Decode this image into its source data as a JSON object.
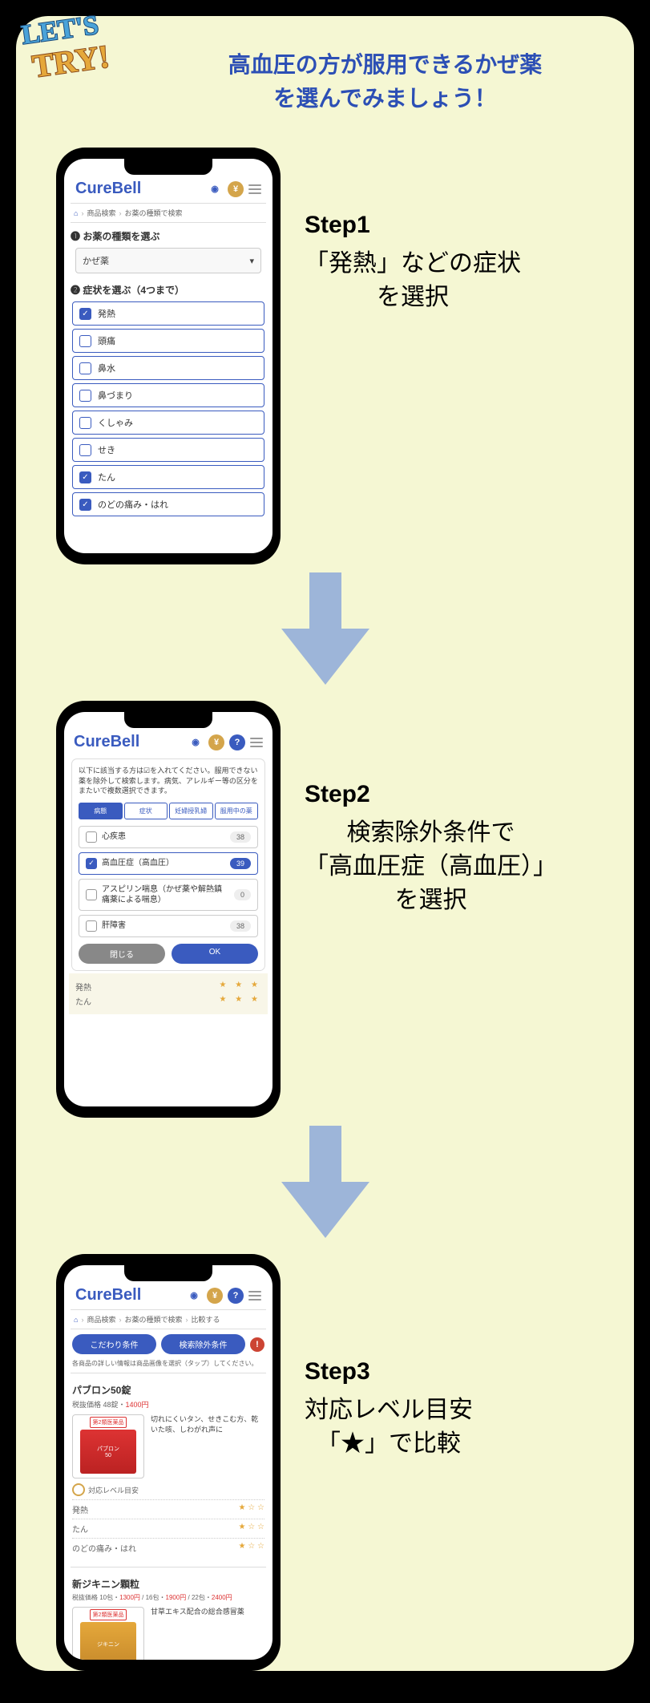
{
  "badge": {
    "line1": "LET'S",
    "line2": "TRY!"
  },
  "headline": "高血圧の方が服用できるかぜ薬\nを選んでみましょう！",
  "app_name": "CureBell",
  "breadcrumb": {
    "home": "⌂",
    "level1": "商品検索",
    "level2": "お薬の種類で検索",
    "level3": "比較する"
  },
  "step1": {
    "title": "Step1",
    "desc": "「発熱」などの症状\nを選択",
    "section1": "❶ お薬の種類を選ぶ",
    "select_value": "かぜ薬",
    "section2": "❷ 症状を選ぶ（4つまで）",
    "symptoms": [
      {
        "label": "発熱",
        "checked": true
      },
      {
        "label": "頭痛",
        "checked": false
      },
      {
        "label": "鼻水",
        "checked": false
      },
      {
        "label": "鼻づまり",
        "checked": false
      },
      {
        "label": "くしゃみ",
        "checked": false
      },
      {
        "label": "せき",
        "checked": false
      },
      {
        "label": "たん",
        "checked": true
      },
      {
        "label": "のどの痛み・はれ",
        "checked": true
      }
    ]
  },
  "step2": {
    "title": "Step2",
    "desc": "検索除外条件で\n「高血圧症（高血圧）」\nを選択",
    "modal_text": "以下に該当する方は☑を入れてください。服用できない薬を除外して検索します。病気、アレルギー等の区分をまたいで複数選択できます。",
    "tabs": [
      "病態",
      "症状",
      "妊婦授乳婦",
      "服用中の薬"
    ],
    "conditions": [
      {
        "label": "心疾患",
        "count": "38",
        "checked": false
      },
      {
        "label": "高血圧症（高血圧）",
        "count": "39",
        "checked": true
      },
      {
        "label": "アスピリン喘息（かぜ薬や解熱鎮痛薬による喘息）",
        "count": "0",
        "checked": false
      },
      {
        "label": "肝障害",
        "count": "38",
        "checked": false
      }
    ],
    "btn_close": "閉じる",
    "btn_ok": "OK",
    "bg_row1_label": "発熱",
    "bg_row1_stars": "★ ★ ★",
    "bg_row2_label": "たん",
    "bg_row2_stars": "★ ★ ★"
  },
  "step3": {
    "title": "Step3",
    "desc": "対応レベル目安\n「★」で比較",
    "btn1": "こだわり条件",
    "btn2": "検索除外条件",
    "note": "各商品の詳しい情報は商品画像を選択（タップ）してください。",
    "product1": {
      "name": "パブロン50錠",
      "price_prefix": "税抜価格 48錠・",
      "price": "1400円",
      "tag": "第2類医薬品",
      "desc": "切れにくいタン、せきこむ方、乾いた咳、しわがれ声に",
      "level_label": "対応レベル目安",
      "rows": [
        {
          "label": "発熱",
          "stars": "★ ☆ ☆"
        },
        {
          "label": "たん",
          "stars": "★ ☆ ☆"
        },
        {
          "label": "のどの痛み・はれ",
          "stars": "★ ☆ ☆"
        }
      ]
    },
    "product2": {
      "name": "新ジキニン顆粒",
      "price_text": "税抜価格 10包・1300円 / 16包・1900円 / 22包・2400円",
      "tag": "第2類医薬品",
      "desc": "甘草エキス配合の総合感冒薬"
    }
  }
}
